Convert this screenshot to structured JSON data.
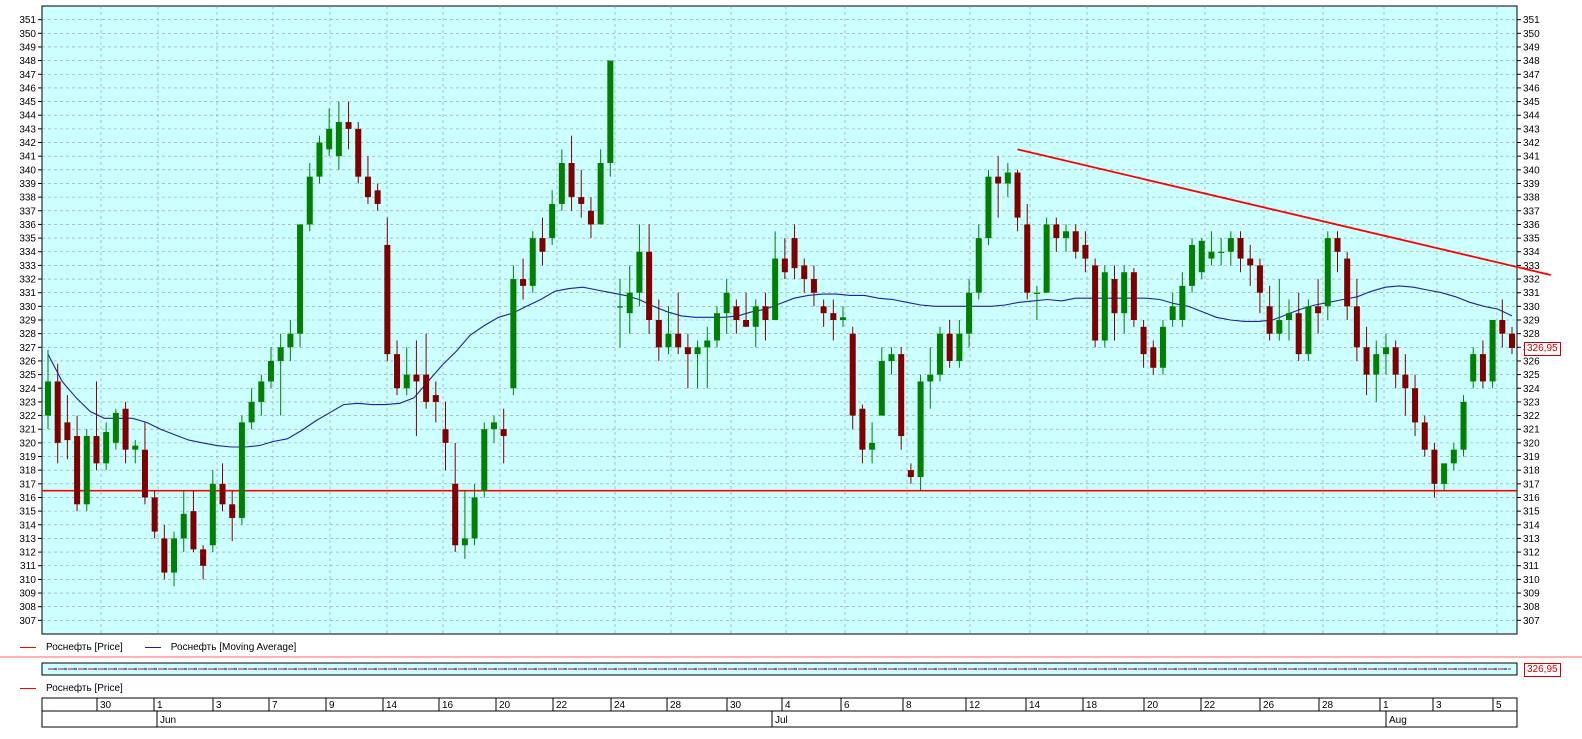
{
  "colors": {
    "plot_bg": "#ccffff",
    "grid": "#999999",
    "up_candle": "#008000",
    "down_candle": "#800000",
    "moving_average": "#2020a0",
    "trendline": "#ff0000",
    "support": "#ff0000"
  },
  "legend": {
    "price": "Роснефть [Price]",
    "ma": "Роснефть [Moving Average]",
    "sub_price": "Роснефть [Price]"
  },
  "last_price_label": "326,95",
  "sub_price_label": "326,95",
  "chart_data": {
    "type": "candlestick",
    "ylim": [
      306,
      352
    ],
    "yticks": [
      307,
      308,
      309,
      310,
      311,
      312,
      313,
      314,
      315,
      316,
      317,
      318,
      319,
      320,
      321,
      322,
      323,
      324,
      325,
      326,
      327,
      328,
      329,
      330,
      331,
      332,
      333,
      334,
      335,
      336,
      337,
      338,
      339,
      340,
      341,
      342,
      343,
      344,
      345,
      346,
      347,
      348,
      349,
      350,
      351
    ],
    "grid": true,
    "x_day_labels": [
      "30",
      "1",
      "3",
      "7",
      "9",
      "14",
      "16",
      "20",
      "22",
      "24",
      "28",
      "30",
      "4",
      "6",
      "8",
      "12",
      "14",
      "18",
      "20",
      "22",
      "26",
      "28",
      "1",
      "3",
      "5"
    ],
    "x_month_labels": [
      "Jun",
      "Jul",
      "Aug"
    ],
    "candles": [
      {
        "o": 322.0,
        "h": 326.8,
        "l": 321.0,
        "c": 324.5
      },
      {
        "o": 324.5,
        "h": 325.8,
        "l": 318.5,
        "c": 320.0
      },
      {
        "o": 321.5,
        "h": 323.5,
        "l": 318.8,
        "c": 320.2
      },
      {
        "o": 320.5,
        "h": 322.0,
        "l": 315.0,
        "c": 315.5
      },
      {
        "o": 315.5,
        "h": 321.0,
        "l": 315.0,
        "c": 320.5
      },
      {
        "o": 320.5,
        "h": 324.5,
        "l": 318.0,
        "c": 318.5
      },
      {
        "o": 318.5,
        "h": 321.5,
        "l": 318.0,
        "c": 320.8
      },
      {
        "o": 320.0,
        "h": 322.5,
        "l": 319.5,
        "c": 322.2
      },
      {
        "o": 322.5,
        "h": 323.0,
        "l": 318.5,
        "c": 319.5
      },
      {
        "o": 319.5,
        "h": 320.2,
        "l": 318.5,
        "c": 319.8
      },
      {
        "o": 319.5,
        "h": 321.5,
        "l": 315.5,
        "c": 316.0
      },
      {
        "o": 316.0,
        "h": 316.5,
        "l": 313.0,
        "c": 313.5
      },
      {
        "o": 313.0,
        "h": 314.0,
        "l": 310.0,
        "c": 310.5
      },
      {
        "o": 310.5,
        "h": 313.5,
        "l": 309.5,
        "c": 313.0
      },
      {
        "o": 313.0,
        "h": 316.5,
        "l": 312.0,
        "c": 314.8
      },
      {
        "o": 315.0,
        "h": 316.5,
        "l": 312.0,
        "c": 312.2
      },
      {
        "o": 312.2,
        "h": 312.5,
        "l": 310.0,
        "c": 311.0
      },
      {
        "o": 312.5,
        "h": 318.0,
        "l": 312.0,
        "c": 317.0
      },
      {
        "o": 317.0,
        "h": 318.5,
        "l": 315.0,
        "c": 315.5
      },
      {
        "o": 315.5,
        "h": 316.5,
        "l": 312.8,
        "c": 314.5
      },
      {
        "o": 314.5,
        "h": 322.0,
        "l": 314.0,
        "c": 321.5
      },
      {
        "o": 321.5,
        "h": 324.0,
        "l": 321.0,
        "c": 323.0
      },
      {
        "o": 323.0,
        "h": 325.0,
        "l": 322.0,
        "c": 324.5
      },
      {
        "o": 324.5,
        "h": 327.0,
        "l": 324.0,
        "c": 326.0
      },
      {
        "o": 326.0,
        "h": 328.0,
        "l": 322.0,
        "c": 327.0
      },
      {
        "o": 327.0,
        "h": 329.0,
        "l": 326.0,
        "c": 328.0
      },
      {
        "o": 328.0,
        "h": 336.0,
        "l": 327.0,
        "c": 336.0
      },
      {
        "o": 336.0,
        "h": 340.5,
        "l": 335.5,
        "c": 339.5
      },
      {
        "o": 339.5,
        "h": 342.5,
        "l": 339.0,
        "c": 342.0
      },
      {
        "o": 341.5,
        "h": 344.5,
        "l": 341.0,
        "c": 343.0
      },
      {
        "o": 341.0,
        "h": 345.0,
        "l": 340.0,
        "c": 343.5
      },
      {
        "o": 343.5,
        "h": 345.0,
        "l": 341.5,
        "c": 343.0
      },
      {
        "o": 343.0,
        "h": 343.5,
        "l": 339.0,
        "c": 339.5
      },
      {
        "o": 339.5,
        "h": 341.0,
        "l": 337.5,
        "c": 338.0
      },
      {
        "o": 338.5,
        "h": 339.0,
        "l": 337.0,
        "c": 337.5
      },
      {
        "o": 334.5,
        "h": 336.5,
        "l": 326.0,
        "c": 326.5
      },
      {
        "o": 326.5,
        "h": 327.5,
        "l": 323.5,
        "c": 324.0
      },
      {
        "o": 324.0,
        "h": 327.0,
        "l": 323.5,
        "c": 325.0
      },
      {
        "o": 325.0,
        "h": 327.5,
        "l": 320.5,
        "c": 324.5
      },
      {
        "o": 325.0,
        "h": 328.0,
        "l": 322.5,
        "c": 323.0
      },
      {
        "o": 323.5,
        "h": 324.5,
        "l": 321.5,
        "c": 323.0
      },
      {
        "o": 321.0,
        "h": 323.0,
        "l": 318.0,
        "c": 320.0
      },
      {
        "o": 317.0,
        "h": 320.0,
        "l": 312.0,
        "c": 312.5
      },
      {
        "o": 312.5,
        "h": 316.5,
        "l": 311.5,
        "c": 313.0
      },
      {
        "o": 313.0,
        "h": 317.0,
        "l": 312.5,
        "c": 316.0
      },
      {
        "o": 316.5,
        "h": 321.5,
        "l": 316.0,
        "c": 321.0
      },
      {
        "o": 321.0,
        "h": 322.0,
        "l": 320.0,
        "c": 321.5
      },
      {
        "o": 321.0,
        "h": 322.5,
        "l": 318.5,
        "c": 320.5
      },
      {
        "o": 324.0,
        "h": 333.0,
        "l": 323.5,
        "c": 332.0
      },
      {
        "o": 332.0,
        "h": 333.5,
        "l": 330.5,
        "c": 331.5
      },
      {
        "o": 331.5,
        "h": 335.5,
        "l": 331.0,
        "c": 335.0
      },
      {
        "o": 335.0,
        "h": 336.5,
        "l": 333.0,
        "c": 334.0
      },
      {
        "o": 335.0,
        "h": 338.5,
        "l": 334.5,
        "c": 337.5
      },
      {
        "o": 337.5,
        "h": 341.5,
        "l": 337.0,
        "c": 340.5
      },
      {
        "o": 340.5,
        "h": 342.5,
        "l": 337.0,
        "c": 338.0
      },
      {
        "o": 338.0,
        "h": 340.0,
        "l": 336.5,
        "c": 337.5
      },
      {
        "o": 337.0,
        "h": 338.0,
        "l": 335.0,
        "c": 336.0
      },
      {
        "o": 336.0,
        "h": 341.5,
        "l": 336.0,
        "c": 340.5
      },
      {
        "o": 340.5,
        "h": 348.0,
        "l": 339.5,
        "c": 348.0
      },
      {
        "o": 330.0,
        "h": 332.0,
        "l": 327.0,
        "c": 330.0
      },
      {
        "o": 329.5,
        "h": 333.0,
        "l": 328.0,
        "c": 331.0
      },
      {
        "o": 331.0,
        "h": 336.0,
        "l": 330.0,
        "c": 334.0
      },
      {
        "o": 334.0,
        "h": 336.0,
        "l": 328.0,
        "c": 329.0
      },
      {
        "o": 329.0,
        "h": 330.5,
        "l": 326.0,
        "c": 327.0
      },
      {
        "o": 327.0,
        "h": 330.0,
        "l": 326.5,
        "c": 328.0
      },
      {
        "o": 328.0,
        "h": 331.0,
        "l": 326.5,
        "c": 327.0
      },
      {
        "o": 327.0,
        "h": 328.0,
        "l": 324.0,
        "c": 326.5
      },
      {
        "o": 326.5,
        "h": 327.5,
        "l": 324.0,
        "c": 327.0
      },
      {
        "o": 327.0,
        "h": 328.5,
        "l": 324.0,
        "c": 327.5
      },
      {
        "o": 327.5,
        "h": 330.0,
        "l": 327.0,
        "c": 329.5
      },
      {
        "o": 329.5,
        "h": 332.0,
        "l": 328.0,
        "c": 331.0
      },
      {
        "o": 330.0,
        "h": 330.5,
        "l": 328.0,
        "c": 329.0
      },
      {
        "o": 329.0,
        "h": 331.0,
        "l": 328.5,
        "c": 328.5
      },
      {
        "o": 328.5,
        "h": 330.5,
        "l": 327.0,
        "c": 330.0
      },
      {
        "o": 330.0,
        "h": 331.0,
        "l": 327.5,
        "c": 329.0
      },
      {
        "o": 329.0,
        "h": 335.5,
        "l": 329.0,
        "c": 333.5
      },
      {
        "o": 333.5,
        "h": 335.0,
        "l": 332.0,
        "c": 332.5
      },
      {
        "o": 335.0,
        "h": 336.0,
        "l": 332.0,
        "c": 332.8
      },
      {
        "o": 333.0,
        "h": 333.5,
        "l": 331.0,
        "c": 332.0
      },
      {
        "o": 332.0,
        "h": 333.0,
        "l": 330.0,
        "c": 331.0
      },
      {
        "o": 330.0,
        "h": 330.5,
        "l": 328.5,
        "c": 329.5
      },
      {
        "o": 329.5,
        "h": 330.5,
        "l": 327.5,
        "c": 329.0
      },
      {
        "o": 329.0,
        "h": 330.0,
        "l": 328.5,
        "c": 329.2
      },
      {
        "o": 328.0,
        "h": 328.5,
        "l": 321.0,
        "c": 322.0
      },
      {
        "o": 322.5,
        "h": 322.8,
        "l": 318.5,
        "c": 319.5
      },
      {
        "o": 319.5,
        "h": 321.5,
        "l": 318.5,
        "c": 320.0
      },
      {
        "o": 322.0,
        "h": 327.0,
        "l": 322.0,
        "c": 326.0
      },
      {
        "o": 326.0,
        "h": 327.0,
        "l": 325.0,
        "c": 326.5
      },
      {
        "o": 326.5,
        "h": 327.0,
        "l": 319.5,
        "c": 320.5
      },
      {
        "o": 318.0,
        "h": 318.5,
        "l": 317.0,
        "c": 317.5
      },
      {
        "o": 317.5,
        "h": 325.0,
        "l": 316.5,
        "c": 324.5
      },
      {
        "o": 324.5,
        "h": 327.0,
        "l": 322.5,
        "c": 325.0
      },
      {
        "o": 325.0,
        "h": 328.5,
        "l": 324.5,
        "c": 328.0
      },
      {
        "o": 328.0,
        "h": 329.0,
        "l": 325.5,
        "c": 326.0
      },
      {
        "o": 326.0,
        "h": 329.0,
        "l": 325.5,
        "c": 328.0
      },
      {
        "o": 328.0,
        "h": 332.0,
        "l": 327.0,
        "c": 331.0
      },
      {
        "o": 331.0,
        "h": 336.0,
        "l": 330.5,
        "c": 335.0
      },
      {
        "o": 335.0,
        "h": 340.0,
        "l": 334.5,
        "c": 339.5
      },
      {
        "o": 339.5,
        "h": 341.0,
        "l": 336.5,
        "c": 339.0
      },
      {
        "o": 339.0,
        "h": 340.5,
        "l": 338.0,
        "c": 339.8
      },
      {
        "o": 339.8,
        "h": 340.0,
        "l": 335.5,
        "c": 336.5
      },
      {
        "o": 336.0,
        "h": 337.5,
        "l": 330.5,
        "c": 331.0
      },
      {
        "o": 331.0,
        "h": 331.5,
        "l": 329.0,
        "c": 331.0
      },
      {
        "o": 331.0,
        "h": 336.5,
        "l": 331.0,
        "c": 336.0
      },
      {
        "o": 336.0,
        "h": 336.5,
        "l": 334.0,
        "c": 335.0
      },
      {
        "o": 335.0,
        "h": 336.0,
        "l": 334.0,
        "c": 335.5
      },
      {
        "o": 335.5,
        "h": 336.0,
        "l": 333.5,
        "c": 334.0
      },
      {
        "o": 334.5,
        "h": 335.5,
        "l": 332.5,
        "c": 333.5
      },
      {
        "o": 333.0,
        "h": 333.5,
        "l": 327.0,
        "c": 327.5
      },
      {
        "o": 327.5,
        "h": 333.0,
        "l": 327.0,
        "c": 332.5
      },
      {
        "o": 332.0,
        "h": 333.0,
        "l": 327.5,
        "c": 329.5
      },
      {
        "o": 329.5,
        "h": 333.0,
        "l": 328.0,
        "c": 332.5
      },
      {
        "o": 332.5,
        "h": 332.8,
        "l": 328.5,
        "c": 329.0
      },
      {
        "o": 328.5,
        "h": 329.0,
        "l": 325.5,
        "c": 326.5
      },
      {
        "o": 327.0,
        "h": 327.5,
        "l": 325.0,
        "c": 325.5
      },
      {
        "o": 325.5,
        "h": 329.0,
        "l": 325.0,
        "c": 328.5
      },
      {
        "o": 329.0,
        "h": 331.0,
        "l": 328.5,
        "c": 330.0
      },
      {
        "o": 329.0,
        "h": 332.5,
        "l": 328.5,
        "c": 331.5
      },
      {
        "o": 331.5,
        "h": 335.0,
        "l": 331.0,
        "c": 334.5
      },
      {
        "o": 332.5,
        "h": 335.0,
        "l": 332.0,
        "c": 334.8
      },
      {
        "o": 333.5,
        "h": 335.5,
        "l": 333.0,
        "c": 334.0
      },
      {
        "o": 334.0,
        "h": 335.0,
        "l": 333.0,
        "c": 334.0
      },
      {
        "o": 334.0,
        "h": 335.5,
        "l": 333.0,
        "c": 335.0
      },
      {
        "o": 335.0,
        "h": 335.5,
        "l": 332.5,
        "c": 333.5
      },
      {
        "o": 333.5,
        "h": 334.5,
        "l": 331.5,
        "c": 333.0
      },
      {
        "o": 333.0,
        "h": 333.5,
        "l": 329.5,
        "c": 331.0
      },
      {
        "o": 330.0,
        "h": 331.5,
        "l": 327.5,
        "c": 328.0
      },
      {
        "o": 328.0,
        "h": 332.0,
        "l": 327.5,
        "c": 329.0
      },
      {
        "o": 329.0,
        "h": 330.5,
        "l": 327.5,
        "c": 329.5
      },
      {
        "o": 329.5,
        "h": 331.0,
        "l": 326.0,
        "c": 326.5
      },
      {
        "o": 326.5,
        "h": 330.5,
        "l": 326.0,
        "c": 330.0
      },
      {
        "o": 330.0,
        "h": 332.0,
        "l": 328.0,
        "c": 329.5
      },
      {
        "o": 330.0,
        "h": 335.5,
        "l": 329.0,
        "c": 335.0
      },
      {
        "o": 335.0,
        "h": 335.5,
        "l": 332.5,
        "c": 334.0
      },
      {
        "o": 333.5,
        "h": 334.0,
        "l": 329.0,
        "c": 330.0
      },
      {
        "o": 330.0,
        "h": 332.0,
        "l": 326.0,
        "c": 327.0
      },
      {
        "o": 327.0,
        "h": 328.5,
        "l": 323.5,
        "c": 325.0
      },
      {
        "o": 325.0,
        "h": 327.5,
        "l": 323.0,
        "c": 326.5
      },
      {
        "o": 326.5,
        "h": 328.0,
        "l": 325.0,
        "c": 327.0
      },
      {
        "o": 327.0,
        "h": 327.5,
        "l": 324.0,
        "c": 325.0
      },
      {
        "o": 325.0,
        "h": 326.5,
        "l": 322.0,
        "c": 324.0
      },
      {
        "o": 324.0,
        "h": 325.0,
        "l": 320.5,
        "c": 321.5
      },
      {
        "o": 321.5,
        "h": 322.0,
        "l": 319.0,
        "c": 319.5
      },
      {
        "o": 319.5,
        "h": 320.0,
        "l": 316.0,
        "c": 317.0
      },
      {
        "o": 317.0,
        "h": 318.0,
        "l": 316.5,
        "c": 318.5
      },
      {
        "o": 318.5,
        "h": 320.0,
        "l": 318.0,
        "c": 319.5
      },
      {
        "o": 319.5,
        "h": 323.5,
        "l": 319.0,
        "c": 323.0
      },
      {
        "o": 324.5,
        "h": 327.0,
        "l": 324.0,
        "c": 326.5
      },
      {
        "o": 326.5,
        "h": 327.5,
        "l": 324.0,
        "c": 324.5
      },
      {
        "o": 324.5,
        "h": 329.0,
        "l": 324.0,
        "c": 329.0
      },
      {
        "o": 329.0,
        "h": 330.5,
        "l": 327.0,
        "c": 328.0
      },
      {
        "o": 328.0,
        "h": 328.5,
        "l": 326.5,
        "c": 326.95
      }
    ],
    "moving_average": [
      326.5,
      324.5,
      323.3,
      322.3,
      321.8,
      321.8,
      321.8,
      321.5,
      321.0,
      320.6,
      320.2,
      320.0,
      319.8,
      319.7,
      319.7,
      319.8,
      320.1,
      320.3,
      320.9,
      321.6,
      322.2,
      322.8,
      322.9,
      322.8,
      322.8,
      322.9,
      323.3,
      324.5,
      325.7,
      326.7,
      327.9,
      328.6,
      329.2,
      329.5,
      330.0,
      330.5,
      331.1,
      331.3,
      331.4,
      331.2,
      331.0,
      330.8,
      330.5,
      330.0,
      329.6,
      329.3,
      329.2,
      329.2,
      329.2,
      329.3,
      329.6,
      329.8,
      330.2,
      330.6,
      330.8,
      330.9,
      330.9,
      330.8,
      330.8,
      330.6,
      330.5,
      330.3,
      330.1,
      330.0,
      330.0,
      330.0,
      330.0,
      330.0,
      330.1,
      330.3,
      330.4,
      330.5,
      330.4,
      330.6,
      330.6,
      330.6,
      330.6,
      330.6,
      330.6,
      330.5,
      330.2,
      330.0,
      329.6,
      329.2,
      329.0,
      328.9,
      328.9,
      329.0,
      329.4,
      329.8,
      330.1,
      330.3,
      330.5,
      330.7,
      331.1,
      331.4,
      331.5,
      331.4,
      331.2,
      331.0,
      330.7,
      330.3,
      330.0,
      329.8,
      329.3
    ],
    "trendline": {
      "from": {
        "i": 100,
        "y": 341.5
      },
      "to": {
        "i": 155,
        "y": 332.3
      }
    },
    "support_level": 316.5
  }
}
